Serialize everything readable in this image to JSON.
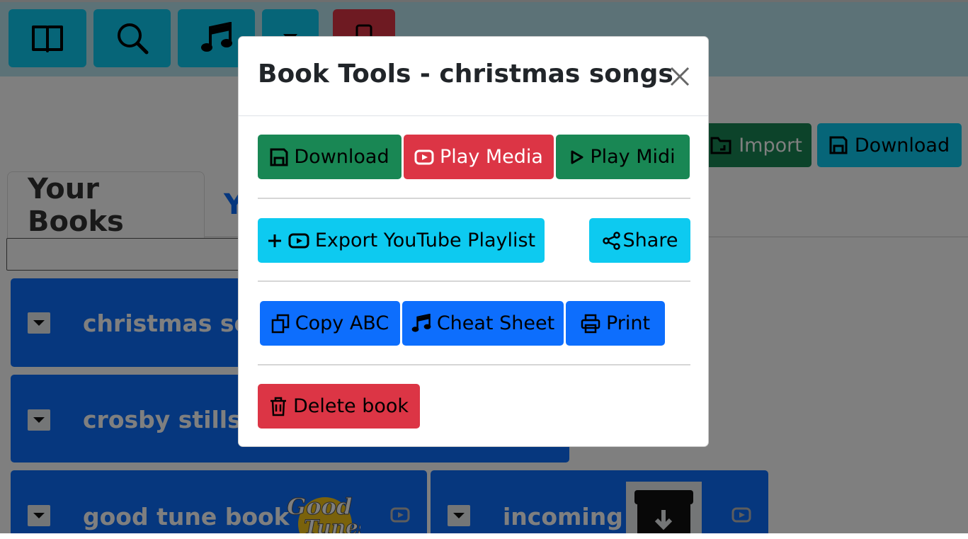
{
  "colors": {
    "cyan": "#0dcaf0",
    "green": "#198754",
    "red": "#dc3545",
    "blue": "#0d6efd",
    "overlay": "rgba(0,0,0,0.5)"
  },
  "nav": {
    "items": [
      {
        "name": "book-icon"
      },
      {
        "name": "search-icon"
      },
      {
        "name": "music-note-icon"
      },
      {
        "name": "dropdown-caret-icon"
      },
      {
        "name": "phone-icon"
      }
    ]
  },
  "toolbar": {
    "import_label": "Import",
    "download_label": "Download"
  },
  "tabs": {
    "your_books": "Your Books",
    "other": "Y"
  },
  "books": [
    {
      "title": "christmas son"
    },
    {
      "title": "crosby stills n"
    },
    {
      "title": "good tune book"
    },
    {
      "title": "incoming"
    }
  ],
  "modal": {
    "title": "Book Tools - christmas songs",
    "buttons": {
      "download": "Download",
      "play_media": "Play Media",
      "play_midi": "Play Midi",
      "export_playlist": "Export YouTube Playlist",
      "share": "Share",
      "copy_abc": "Copy ABC",
      "cheat_sheet": "Cheat Sheet",
      "print": "Print",
      "delete_book": "Delete book"
    }
  }
}
